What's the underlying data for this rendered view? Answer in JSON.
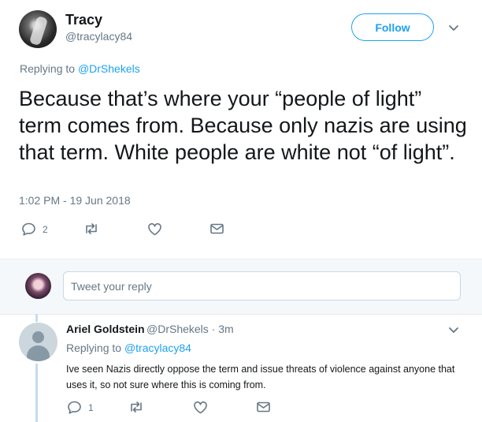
{
  "main_tweet": {
    "display_name": "Tracy",
    "handle": "@tracylacy84",
    "follow_label": "Follow",
    "replying_prefix": "Replying to",
    "replying_to": "@DrShekels",
    "text": "Because that’s where your “people of light” term comes from. Because only nazis are using that term. White people are white not “of light”.",
    "timestamp": "1:02 PM - 19 Jun 2018",
    "actions": {
      "reply_count": "2",
      "retweet_count": "",
      "like_count": ""
    }
  },
  "reply_box": {
    "placeholder": "Tweet your reply"
  },
  "reply_tweet": {
    "display_name": "Ariel Goldstein",
    "handle_and_time": "@DrShekels · 3m",
    "replying_prefix": "Replying to",
    "replying_to": "@tracylacy84",
    "text": "Ive seen Nazis directly oppose the term and issue threats of violence against anyone that uses it, so not sure where this is coming from.",
    "actions": {
      "reply_count": "1",
      "retweet_count": "",
      "like_count": ""
    }
  },
  "colors": {
    "accent": "#1da1f2",
    "secondary_text": "#657786",
    "divider": "#e6ecf0",
    "thread_line": "#c4dcf1"
  },
  "icons": [
    "chevron-down-icon",
    "reply-icon",
    "retweet-icon",
    "like-icon",
    "message-icon",
    "avatar"
  ]
}
